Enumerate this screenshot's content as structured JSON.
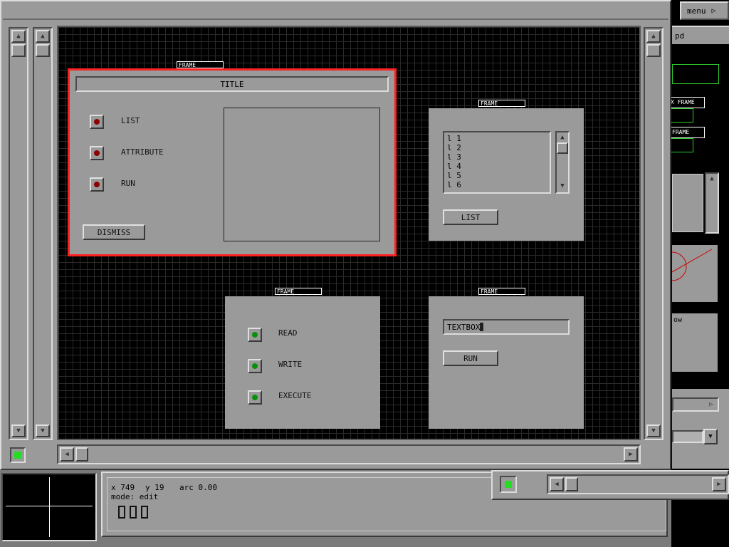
{
  "menu_label": "menu",
  "right_panel": {
    "label_pd": "pd",
    "xframe_label": "X FRAME",
    "frame_label": "FRAME",
    "ow_label": "ow"
  },
  "canvas": {
    "frame_tag": "FRAME",
    "main_dialog": {
      "title": "TITLE",
      "options": [
        "LIST",
        "ATTRIBUTE",
        "RUN"
      ],
      "dismiss_label": "DISMISS"
    },
    "list_frame": {
      "items": [
        "l 1",
        "l 2",
        "l 3",
        "l 4",
        "l 5",
        "l 6"
      ],
      "button_label": "LIST"
    },
    "permissions_frame": {
      "options": [
        "READ",
        "WRITE",
        "EXECUTE"
      ]
    },
    "textbox_frame": {
      "textbox_value": "TEXTBOX",
      "button_label": "RUN"
    }
  },
  "status": {
    "x_label": "x 749",
    "y_label": "y 19",
    "arc_label": "arc 0.00",
    "mode_label": "mode: edit"
  },
  "colors": {
    "selection": "#ff2020",
    "indicator_on": "#22dd22",
    "radio_off": "#8b0000",
    "radio_on": "#0b8f0b"
  }
}
